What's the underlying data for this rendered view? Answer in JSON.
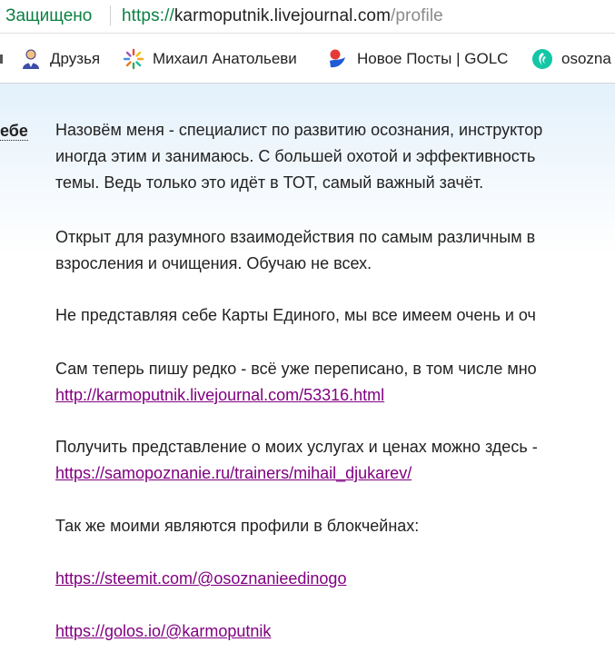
{
  "address_bar": {
    "secure_label": "Защищено",
    "url_scheme": "https://",
    "url_host": "karmoputnik.livejournal.com",
    "url_path": "/profile"
  },
  "bookmarks": [
    {
      "label": "Друзья",
      "icon": "user-icon"
    },
    {
      "label": "Михаил Анатольеви",
      "icon": "sun-burst-icon"
    },
    {
      "label": "Новое Посты | GOLC",
      "icon": "golos-icon"
    },
    {
      "label": "osozna",
      "icon": "steemit-icon"
    }
  ],
  "profile": {
    "side_label": "ебе",
    "about": [
      {
        "lines": [
          "Назовём меня - специалист по развитию осознания, инструктор",
          "иногда этим и занимаюсь. С большей охотой и эффективность",
          "темы. Ведь только это идёт в ТОТ, самый важный зачёт."
        ]
      },
      {
        "lines": [
          "Открыт для разумного взаимодействия по самым различным в",
          "взросления и очищения. Обучаю не всех."
        ]
      },
      {
        "lines": [
          "Не представляя себе Карты Единого, мы все имеем очень и оч"
        ]
      },
      {
        "lines": [
          "Сам теперь пишу редко - всё уже переписано, в том числе мно"
        ],
        "link": "http://karmoputnik.livejournal.com/53316.html"
      },
      {
        "lines": [
          "Получить представление о моих услугах и ценах можно здесь -"
        ],
        "link": "https://samopoznanie.ru/trainers/mihail_djukarev/"
      },
      {
        "lines": [
          "Так же моими являются профили в блокчейнах:"
        ]
      },
      {
        "link": "https://steemit.com/@osoznanieedinogo"
      },
      {
        "link": "https://golos.io/@karmoputnik"
      }
    ]
  },
  "colors": {
    "secure_green": "#0b8043",
    "visited_link": "#800080",
    "text": "#222222"
  }
}
